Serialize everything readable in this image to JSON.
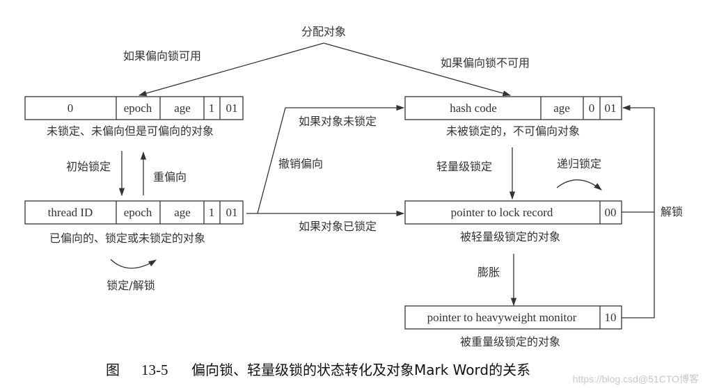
{
  "figure": {
    "caption_prefix": "图",
    "caption_number": "13-5",
    "caption_text": "偏向锁、轻量级锁的状态转化及对象Mark Word的关系",
    "watermark": "https://blog.csd@51CTO博客"
  },
  "nodes": {
    "unlocked_biasable": {
      "cells": [
        "0",
        "epoch",
        "age",
        "1",
        "01"
      ],
      "label": "未锁定、未偏向但是可偏向的对象"
    },
    "biased": {
      "cells": [
        "thread ID",
        "epoch",
        "age",
        "1",
        "01"
      ],
      "label": "已偏向的、锁定或未锁定的对象"
    },
    "unlocked_non_biasable": {
      "cells": [
        "hash code",
        "age",
        "0",
        "01"
      ],
      "label": "未被锁定的，不可偏向对象"
    },
    "lightweight_locked": {
      "cells": [
        "pointer to lock record",
        "00"
      ],
      "label": "被轻量级锁定的对象"
    },
    "heavyweight_locked": {
      "cells": [
        "pointer to heavyweight monitor",
        "10"
      ],
      "label": "被重量级锁定的对象"
    }
  },
  "edges": {
    "allocate": "分配对象",
    "bias_available": "如果偏向锁可用",
    "bias_unavailable": "如果偏向锁不可用",
    "initial_lock": "初始锁定",
    "rebias": "重偏向",
    "lock_unlock": "锁定/解锁",
    "revoke_bias": "撤销偏向",
    "if_not_locked": "如果对象未锁定",
    "if_locked": "如果对象已锁定",
    "lightweight_lock": "轻量级锁定",
    "recursive_lock": "递归锁定",
    "inflate": "膨胀",
    "unlock": "解锁"
  }
}
